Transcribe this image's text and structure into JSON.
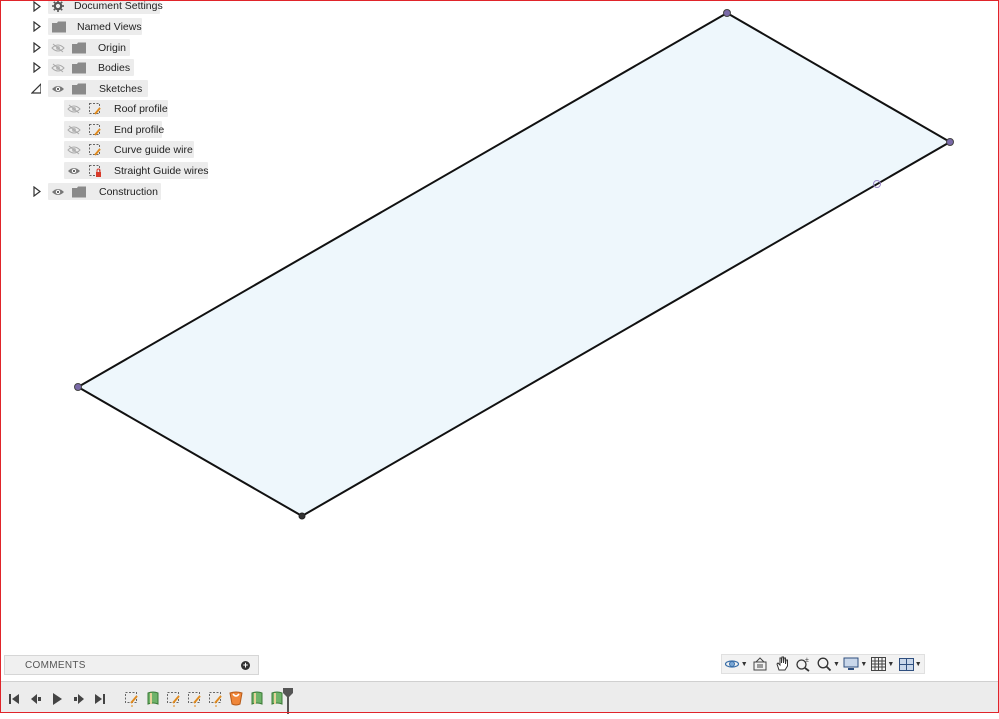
{
  "browser": {
    "items": [
      {
        "label": "Document Settings",
        "icon": "gear-icon",
        "expanded": false
      },
      {
        "label": "Named Views",
        "icon": "folder-icon",
        "expanded": false
      },
      {
        "label": "Origin",
        "icon": "folder-icon",
        "visibility": "hidden",
        "expanded": false
      },
      {
        "label": "Bodies",
        "icon": "folder-icon",
        "visibility": "hidden",
        "expanded": false
      },
      {
        "label": "Sketches",
        "icon": "folder-icon",
        "visibility": "visible",
        "expanded": true,
        "children": [
          {
            "label": "Roof profile",
            "visibility": "hidden"
          },
          {
            "label": "End profile",
            "visibility": "hidden"
          },
          {
            "label": "Curve guide wire",
            "visibility": "hidden"
          },
          {
            "label": "Straight Guide wires",
            "visibility": "visible",
            "locked": true
          }
        ]
      },
      {
        "label": "Construction",
        "icon": "folder-icon",
        "visibility": "visible",
        "expanded": false
      }
    ]
  },
  "comments": {
    "label": "COMMENTS"
  },
  "navigation_toolbar": [
    "orbit-icon",
    "look-at-icon",
    "pan-icon",
    "zoom-icon",
    "fit-icon",
    "display-settings-icon",
    "grid-icon",
    "viewports-icon"
  ],
  "timeline": {
    "controls": [
      "go-to-start-icon",
      "step-back-icon",
      "play-icon",
      "step-forward-icon",
      "go-to-end-icon"
    ],
    "features": [
      "sketch-icon",
      "loft-icon",
      "sketch-icon",
      "sketch-icon",
      "sketch-icon",
      "loft-icon-active",
      "loft-icon",
      "loft-icon"
    ]
  },
  "colors": {
    "face_fill": "#eef7fc",
    "edge": "#1a1a1a",
    "vertex": "#7a6aa8",
    "accent": "#e0242a"
  }
}
